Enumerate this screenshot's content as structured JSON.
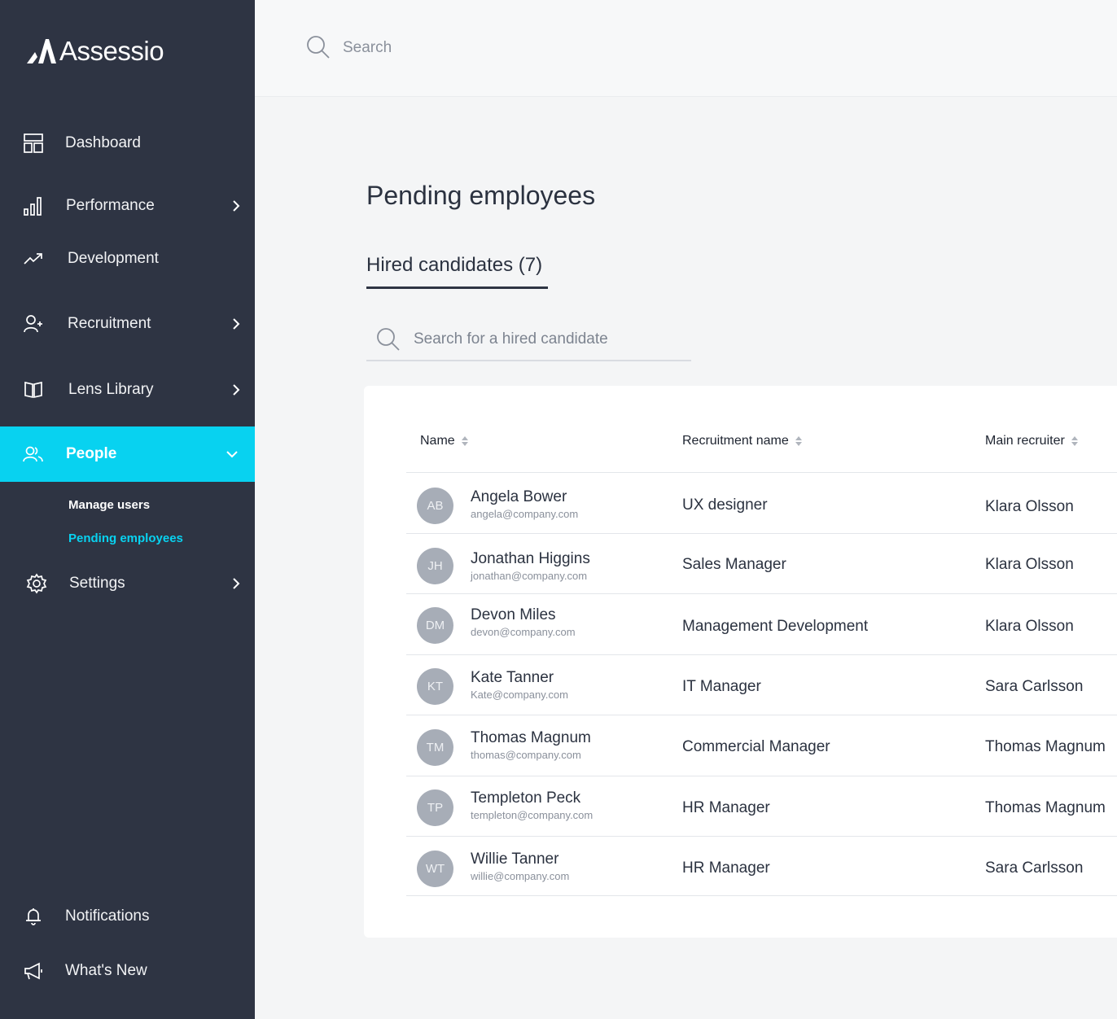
{
  "app": {
    "name": "Assessio"
  },
  "search": {
    "placeholder": "Search"
  },
  "sidebar": {
    "items": [
      {
        "label": "Dashboard",
        "icon": "dashboard-icon"
      },
      {
        "label": "Performance",
        "icon": "bar-chart-icon"
      },
      {
        "label": "Development",
        "icon": "trend-up-icon"
      },
      {
        "label": "Recruitment",
        "icon": "user-plus-icon"
      },
      {
        "label": "Lens Library",
        "icon": "book-icon"
      },
      {
        "label": "People",
        "icon": "users-icon"
      },
      {
        "label": "Settings",
        "icon": "gear-icon"
      }
    ],
    "people_sub": [
      {
        "label": "Manage users"
      },
      {
        "label": "Pending employees"
      }
    ],
    "bottom": [
      {
        "label": "Notifications",
        "icon": "bell-icon"
      },
      {
        "label": "What's New",
        "icon": "megaphone-icon"
      }
    ]
  },
  "main": {
    "title": "Pending employees",
    "tab_label": "Hired candidates (7)",
    "candidate_search_placeholder": "Search for a hired candidate",
    "columns": [
      "Name",
      "Recruitment name",
      "Main recruiter"
    ],
    "rows": [
      {
        "initials": "AB",
        "name": "Angela Bower",
        "email": "angela@company.com",
        "recruitment": "UX designer",
        "recruiter": "Klara Olsson"
      },
      {
        "initials": "JH",
        "name": "Jonathan Higgins",
        "email": "jonathan@company.com",
        "recruitment": "Sales Manager",
        "recruiter": "Klara Olsson"
      },
      {
        "initials": "DM",
        "name": "Devon Miles",
        "email": "devon@company.com",
        "recruitment": "Management Development",
        "recruiter": "Klara Olsson"
      },
      {
        "initials": "KT",
        "name": "Kate Tanner",
        "email": "Kate@company.com",
        "recruitment": "IT Manager",
        "recruiter": "Sara Carlsson"
      },
      {
        "initials": "TM",
        "name": "Thomas Magnum",
        "email": "thomas@company.com",
        "recruitment": "Commercial Manager",
        "recruiter": "Thomas Magnum"
      },
      {
        "initials": "TP",
        "name": "Templeton Peck",
        "email": "templeton@company.com",
        "recruitment": "HR Manager",
        "recruiter": "Thomas Magnum"
      },
      {
        "initials": "WT",
        "name": "Willie Tanner",
        "email": "willie@company.com",
        "recruitment": "HR Manager",
        "recruiter": "Sara Carlsson"
      }
    ]
  },
  "colors": {
    "sidebar": "#2e3443",
    "accent": "#08d2f0",
    "background": "#f4f5f6"
  }
}
